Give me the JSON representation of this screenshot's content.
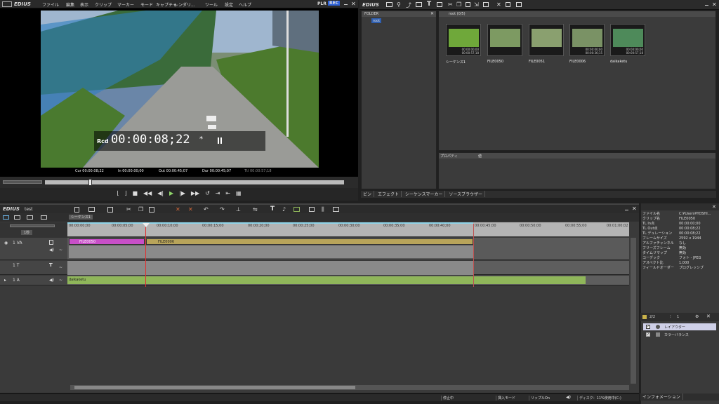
{
  "player": {
    "logo": "EDIUS",
    "menu": [
      "ファイル",
      "編集",
      "表示",
      "クリップ",
      "マーカー",
      "モード",
      "キャプチャ",
      "レンダリ...",
      "ツール",
      "設定",
      "ヘルプ"
    ],
    "plr": "PLR",
    "rec": "REC",
    "rcd_label": "Rcd",
    "timecode": "00:00:08;22",
    "tc_mark": "*",
    "cur": "Cur 00:00:08;22",
    "in": "In 00:00:00;00",
    "out": "Out 00:00:45;07",
    "dur": "Dur 00:00:45;07",
    "ttl": "Ttl 00:00:57;18"
  },
  "bin": {
    "logo": "EDIUS",
    "folder_label": "FOLDER",
    "root_label": "root",
    "root_path": "root (0/5)",
    "clips": [
      {
        "name": "シーケンス1",
        "tc1": "00:00:00;00",
        "tc2": "00:00:57;18"
      },
      {
        "name": "FILE0050",
        "tc1": "",
        "tc2": ""
      },
      {
        "name": "FILE0051",
        "tc1": "",
        "tc2": ""
      },
      {
        "name": "FILE0006",
        "tc1": "00:00:00;00",
        "tc2": "00:00:36;15"
      },
      {
        "name": "daikaketu",
        "tc1": "00:00:00;00",
        "tc2": "00:00:57;18"
      }
    ],
    "prop_col": "プロパティ",
    "val_col": "値",
    "tabs": [
      "ビン",
      "エフェクト",
      "シーケンスマーカー",
      "ソースブラウザー"
    ]
  },
  "timeline": {
    "logo": "EDIUS",
    "project": "test",
    "seq_tab": "シーケンス1",
    "ticks": [
      "00:00:00;00",
      "00:00:05;00",
      "00:00:10;00",
      "00:00:15;00",
      "00:00:20;00",
      "00:00:25;00",
      "00:00:30;00",
      "00:00:35;00",
      "00:00:40;00",
      "00:00:45;00",
      "00:00:50;00",
      "00:00:55;00",
      "00:01:00;02"
    ],
    "tracks": [
      {
        "label": "1 VA"
      },
      {
        "label": "1 T"
      },
      {
        "label": "1 A"
      }
    ],
    "clip_a": "FILE0050",
    "clip_b": "FILE0006",
    "clip_audio": "daikaketu",
    "mode_select": "1秒"
  },
  "info": {
    "rows": [
      {
        "k": "ファイル名",
        "v": "C:¥Users¥YOSHI..."
      },
      {
        "k": "クリップ名",
        "v": "FILE0050"
      },
      {
        "k": "TL In点",
        "v": "00:00:00;00"
      },
      {
        "k": "TL Out点",
        "v": "00:00:08;22"
      },
      {
        "k": "TL デュレーション",
        "v": "00:00:08;22"
      },
      {
        "k": "フレームサイズ",
        "v": "2592 x 1944"
      },
      {
        "k": "アルファチャンネル",
        "v": "なし"
      },
      {
        "k": "フリーズフレーム",
        "v": "無効"
      },
      {
        "k": "タイムリマップ",
        "v": "無効"
      },
      {
        "k": "コーデック",
        "v": "フォト - JPEG"
      },
      {
        "k": "アスペクト比",
        "v": "1.000"
      },
      {
        "k": "フィールドオーダー",
        "v": "プログレッシブ"
      }
    ],
    "filter_count": "2/2",
    "key_count": "1",
    "filters": [
      "レイアウター",
      "カラーバランス"
    ],
    "tab": "インフォメーション"
  },
  "status": {
    "state": "停止中",
    "mode": "挿入モード",
    "ripple": "リップルOn",
    "disk": "ディスク：11%使用中(C:)"
  },
  "colors": {
    "clip_pink": "#c84fc8",
    "clip_gold": "#b8a45a",
    "audio_green": "#8fb65a",
    "in_out": "#8fd4e8"
  }
}
